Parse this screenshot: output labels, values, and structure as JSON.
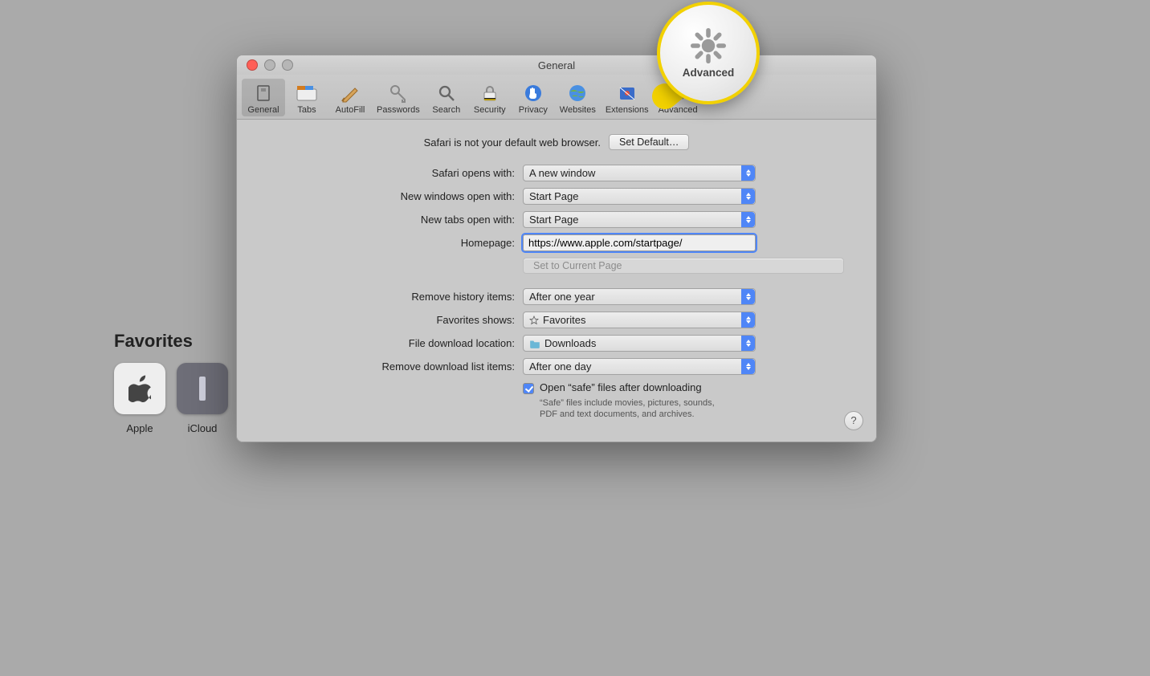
{
  "background": {
    "favorites_title": "Favorites",
    "items": [
      {
        "label": "Apple"
      },
      {
        "label": "iCloud"
      }
    ]
  },
  "window": {
    "title": "General",
    "toolbar": [
      {
        "id": "general",
        "label": "General",
        "active": true
      },
      {
        "id": "tabs",
        "label": "Tabs",
        "active": false
      },
      {
        "id": "autofill",
        "label": "AutoFill",
        "active": false
      },
      {
        "id": "passwords",
        "label": "Passwords",
        "active": false
      },
      {
        "id": "search",
        "label": "Search",
        "active": false
      },
      {
        "id": "security",
        "label": "Security",
        "active": false
      },
      {
        "id": "privacy",
        "label": "Privacy",
        "active": false
      },
      {
        "id": "websites",
        "label": "Websites",
        "active": false
      },
      {
        "id": "extensions",
        "label": "Extensions",
        "active": false
      },
      {
        "id": "advanced",
        "label": "Advanced",
        "active": false
      }
    ],
    "default_browser_notice": "Safari is not your default web browser.",
    "set_default_button": "Set Default…",
    "fields": {
      "safari_opens": {
        "label": "Safari opens with:",
        "value": "A new window"
      },
      "new_windows": {
        "label": "New windows open with:",
        "value": "Start Page"
      },
      "new_tabs": {
        "label": "New tabs open with:",
        "value": "Start Page"
      },
      "homepage": {
        "label": "Homepage:",
        "value": "https://www.apple.com/startpage/"
      },
      "set_current_page_button": "Set to Current Page",
      "remove_history": {
        "label": "Remove history items:",
        "value": "After one year"
      },
      "favorites_shows": {
        "label": "Favorites shows:",
        "value": "Favorites"
      },
      "download_location": {
        "label": "File download location:",
        "value": "Downloads"
      },
      "remove_downloads": {
        "label": "Remove download list items:",
        "value": "After one day"
      },
      "open_safe_label": "Open “safe” files after downloading",
      "open_safe_checked": true,
      "open_safe_note": "“Safe” files include movies, pictures, sounds, PDF and text documents, and archives."
    },
    "help_button": "?"
  },
  "callout": {
    "label": "Advanced"
  }
}
